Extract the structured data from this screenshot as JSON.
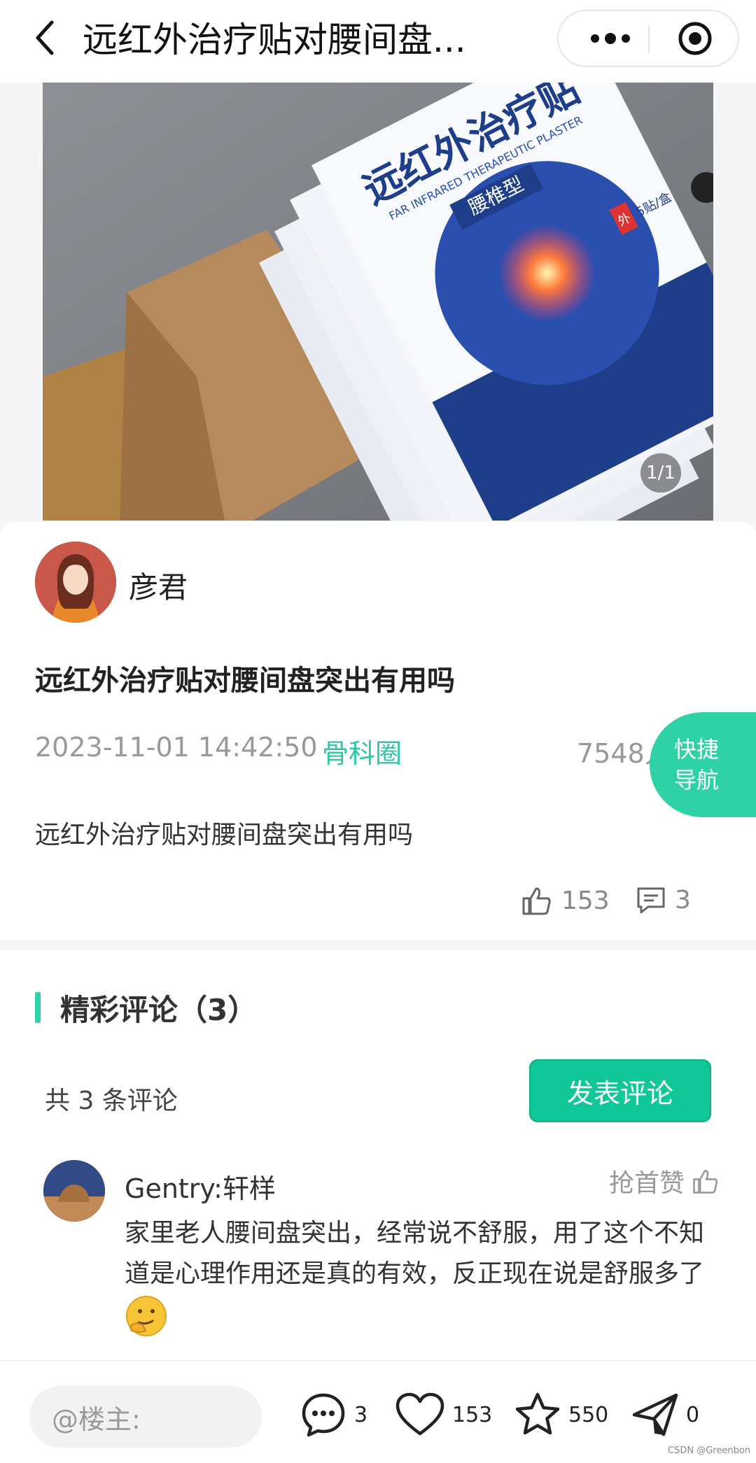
{
  "header": {
    "title": "远红外治疗贴对腰间盘...",
    "back_icon": "chevron-left-icon",
    "more_icon": "more-dots-icon",
    "close_icon": "target-circle-icon"
  },
  "hero": {
    "counter": "1/1",
    "package_title": "远红外治疗贴",
    "package_subtitle": "FAR INFRARED THERAPEUTIC PLASTER",
    "package_type": "腰椎型",
    "package_count": "5贴/盒",
    "package_external": "外"
  },
  "post": {
    "author": "彦君",
    "title": "远红外治疗贴对腰间盘突出有用吗",
    "date": "2023-11-01 14:42:50",
    "circle": "骨科圈",
    "views": "7548人",
    "body": "远红外治疗贴对腰间盘突出有用吗",
    "likes": "153",
    "comments": "3"
  },
  "quick_nav": {
    "line1": "快捷",
    "line2": "导航"
  },
  "comments_section": {
    "title": "精彩评论（3）",
    "count_text": "共 3 条评论",
    "post_button": "发表评论",
    "items": [
      {
        "name": "Gentry:轩样",
        "like_text": "抢首赞",
        "text": "家里老人腰间盘突出，经常说不舒服，用了这个不知道是心理作用还是真的有效，反正现在说是舒服多了"
      }
    ]
  },
  "bottom_bar": {
    "placeholder": "@楼主:",
    "comment_count": "3",
    "like_count": "153",
    "favorite_count": "550",
    "share_count": "0"
  },
  "watermark": "CSDN @Greenbon",
  "colors": {
    "accent": "#2fd1a7",
    "button": "#12c797",
    "circle_text": "#2fc6a8"
  }
}
